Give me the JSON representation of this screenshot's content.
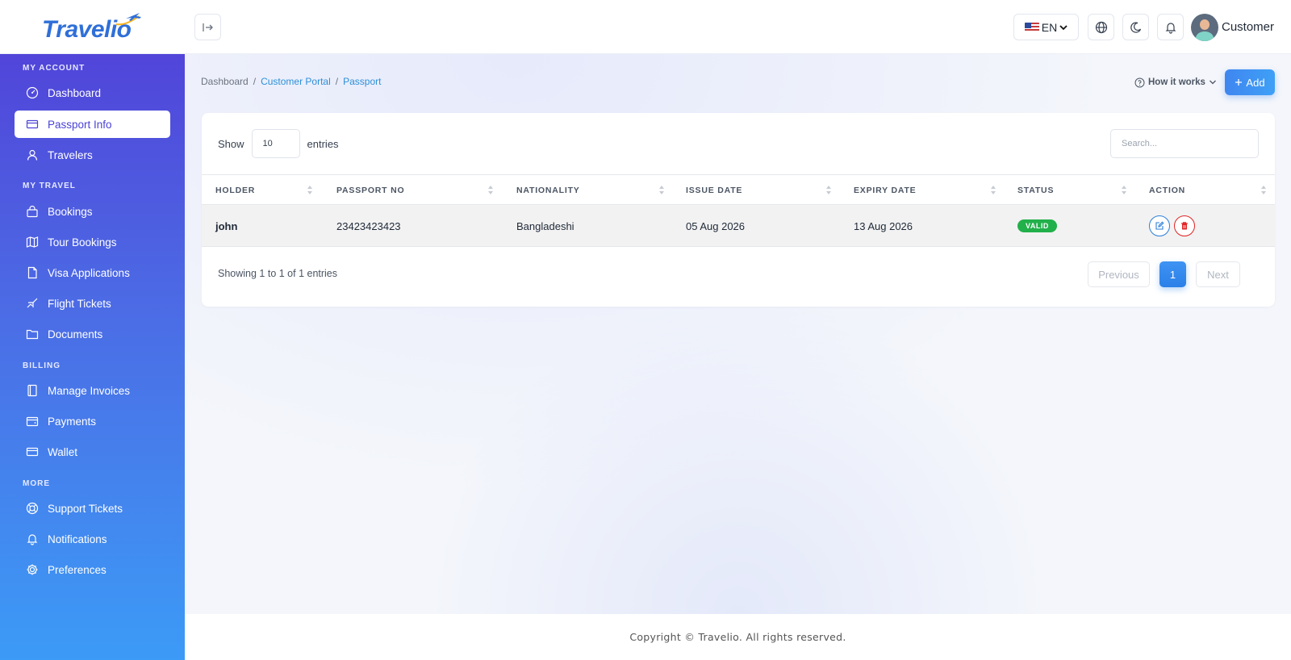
{
  "app": {
    "logo_text": "Travelio"
  },
  "topbar": {
    "language": "EN",
    "user_name": "Customer"
  },
  "sidebar": {
    "sections": [
      {
        "label": "MY ACCOUNT"
      },
      {
        "label": "MY TRAVEL"
      },
      {
        "label": "BILLING"
      },
      {
        "label": "MORE"
      }
    ],
    "items": [
      {
        "label": "Dashboard",
        "icon": "dashboard-icon"
      },
      {
        "label": "Passport Info",
        "icon": "card-icon",
        "active": true
      },
      {
        "label": "Travelers",
        "icon": "user-icon"
      },
      {
        "label": "Bookings",
        "icon": "bag-icon"
      },
      {
        "label": "Tour Bookings",
        "icon": "map-icon"
      },
      {
        "label": "Visa Applications",
        "icon": "file-icon"
      },
      {
        "label": "Flight Tickets",
        "icon": "plane-icon"
      },
      {
        "label": "Documents",
        "icon": "folder-icon"
      },
      {
        "label": "Manage Invoices",
        "icon": "book-icon"
      },
      {
        "label": "Payments",
        "icon": "wallet-icon"
      },
      {
        "label": "Wallet",
        "icon": "credit-card-icon"
      },
      {
        "label": "Support Tickets",
        "icon": "lifebuoy-icon"
      },
      {
        "label": "Notifications",
        "icon": "bell-icon"
      },
      {
        "label": "Preferences",
        "icon": "gear-icon"
      }
    ]
  },
  "breadcrumb": {
    "items": [
      "Dashboard",
      "Customer Portal",
      "Passport"
    ],
    "separator": "/"
  },
  "header_actions": {
    "how_it_works": "How it works",
    "add": "Add"
  },
  "table_controls": {
    "show_label": "Show",
    "entries_value": "10",
    "entries_label": "entries",
    "search_placeholder": "Search..."
  },
  "table": {
    "columns": [
      "HOLDER",
      "PASSPORT NO",
      "NATIONALITY",
      "ISSUE DATE",
      "EXPIRY DATE",
      "STATUS",
      "ACTION"
    ],
    "rows": [
      {
        "holder": "john",
        "passport_no": "23423423423",
        "nationality": "Bangladeshi",
        "issue_date": "05 Aug 2026",
        "expiry_date": "13 Aug 2026",
        "status": "VALID"
      }
    ]
  },
  "pagination": {
    "info": "Showing 1 to 1 of 1 entries",
    "previous": "Previous",
    "current_page": "1",
    "next": "Next"
  },
  "footer": {
    "text": "Copyright © Travelio. All rights reserved."
  },
  "colors": {
    "sidebar_top": "#5145d9",
    "sidebar_bottom": "#3c9bf6",
    "accent": "#3f86f0",
    "status_valid": "#22b04b",
    "danger": "#e02424"
  }
}
